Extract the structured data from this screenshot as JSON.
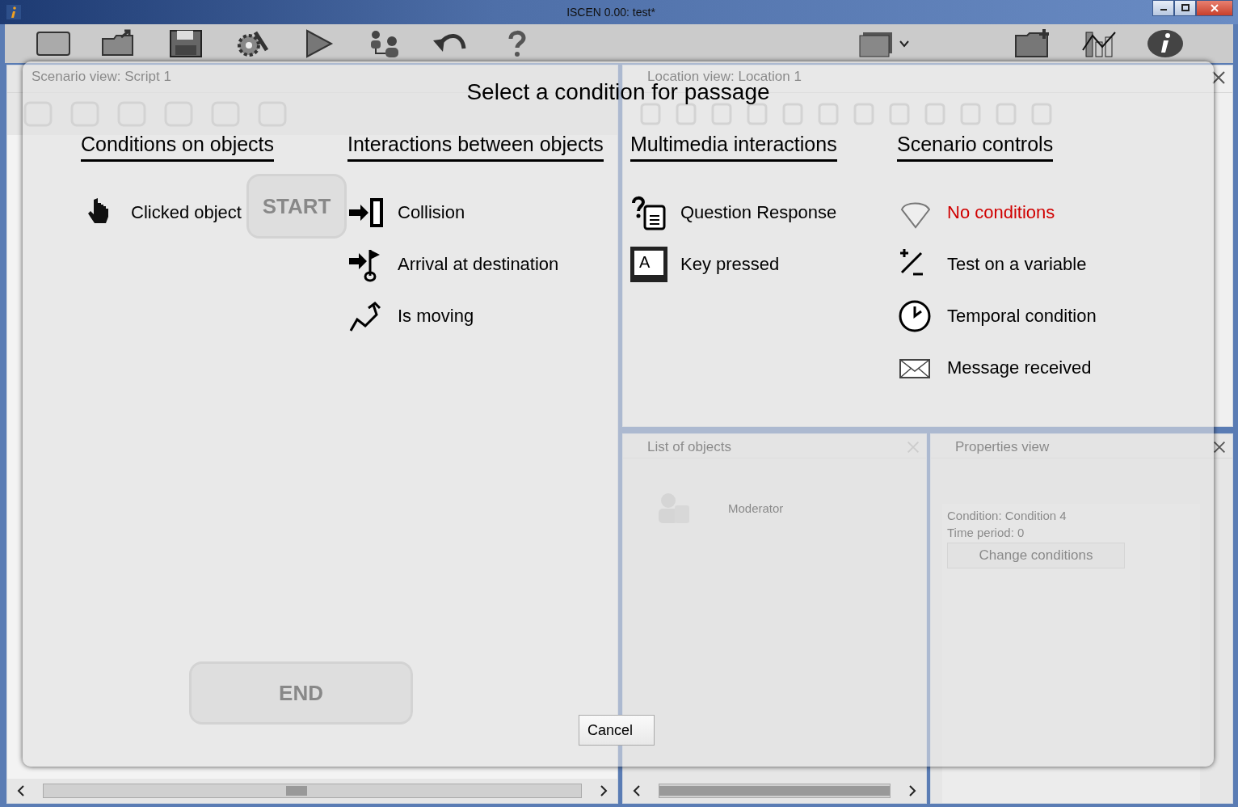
{
  "window": {
    "title": "ISCEN  0.00: test*"
  },
  "background": {
    "scenario_view": {
      "title": "Scenario view: Script 1",
      "start_node": "START",
      "end_node": "END"
    },
    "location_view": {
      "title": "Location view: Location 1"
    },
    "objects_panel": {
      "title": "List of objects",
      "items": [
        "Moderator"
      ]
    },
    "properties_panel": {
      "title": "Properties view",
      "lines": [
        "Condition: Condition 4",
        "Time period: 0"
      ],
      "button": "Change conditions"
    }
  },
  "dialog": {
    "title": "Select a condition for passage",
    "columns": [
      {
        "heading": "Conditions on objects",
        "items": [
          {
            "label": "Clicked object",
            "kind": "hand",
            "selected": false
          }
        ]
      },
      {
        "heading": "Interactions between objects",
        "items": [
          {
            "label": "Collision",
            "kind": "collision",
            "selected": false
          },
          {
            "label": "Arrival at destination",
            "kind": "arrival",
            "selected": false
          },
          {
            "label": "Is moving",
            "kind": "moving",
            "selected": false
          }
        ]
      },
      {
        "heading": "Multimedia interactions",
        "items": [
          {
            "label": "Question Response",
            "kind": "question",
            "selected": false
          },
          {
            "label": "Key pressed",
            "kind": "key",
            "key_cap": "A",
            "selected": false
          }
        ]
      },
      {
        "heading": "Scenario controls",
        "items": [
          {
            "label": "No conditions",
            "kind": "none",
            "selected": true
          },
          {
            "label": "Test on a variable",
            "kind": "variable",
            "selected": false
          },
          {
            "label": "Temporal condition",
            "kind": "clock",
            "selected": false
          },
          {
            "label": "Message received",
            "kind": "message",
            "selected": false
          }
        ]
      }
    ],
    "cancel": "Cancel"
  }
}
